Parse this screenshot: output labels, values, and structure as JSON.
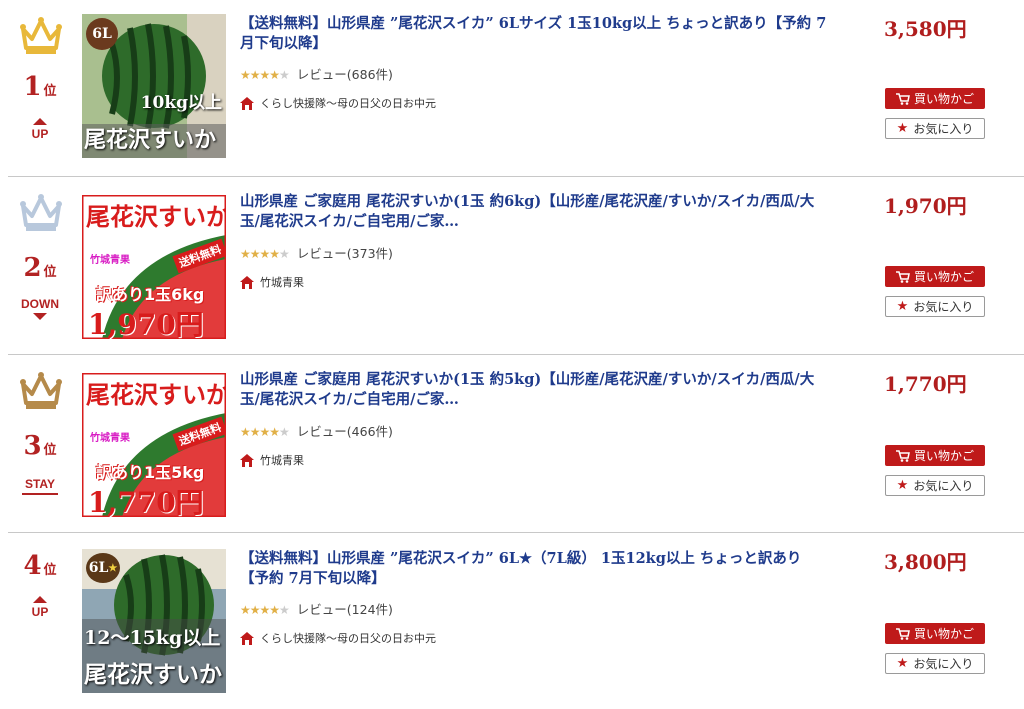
{
  "ranking": {
    "items": [
      {
        "rank": "1",
        "rank_suffix": "位",
        "trend": "UP",
        "crown_color": "#e8b83a",
        "title": "【送料無料】山形県産 ”尾花沢スイカ” 6Lサイズ 1玉10kg以上 ちょっと訳あり【予約 7月下旬以降】",
        "rating_stars": 4,
        "review_label": "レビュー(686件)",
        "shop": "くらし快援隊〜母の日父の日お中元",
        "price": "3,580円",
        "cart_label": "買い物かご",
        "fav_label": "お気に入り",
        "thumb_text": {
          "badge": "6L",
          "weight": "10kg以上",
          "name": "尾花沢すいか"
        }
      },
      {
        "rank": "2",
        "rank_suffix": "位",
        "trend": "DOWN",
        "crown_color": "#b8c8dc",
        "title": "山形県産 ご家庭用 尾花沢すいか(1玉 約6kg)【山形産/尾花沢産/すいか/スイカ/西瓜/大玉/尾花沢スイカ/ご自宅用/ご家…",
        "rating_stars": 4,
        "review_label": "レビュー(373件)",
        "shop": "竹城青果",
        "price": "1,970円",
        "cart_label": "買い物かご",
        "fav_label": "お気に入り",
        "thumb_text": {
          "name": "尾花沢すいか",
          "shop": "竹城青果",
          "tag": "送料無料",
          "desc": "訳あり1玉6kg",
          "price": "1,970円"
        }
      },
      {
        "rank": "3",
        "rank_suffix": "位",
        "trend": "STAY",
        "crown_color": "#b58a4a",
        "title": "山形県産 ご家庭用 尾花沢すいか(1玉 約5kg)【山形産/尾花沢産/すいか/スイカ/西瓜/大玉/尾花沢スイカ/ご自宅用/ご家…",
        "rating_stars": 4,
        "review_label": "レビュー(466件)",
        "shop": "竹城青果",
        "price": "1,770円",
        "cart_label": "買い物かご",
        "fav_label": "お気に入り",
        "thumb_text": {
          "name": "尾花沢すいか",
          "shop": "竹城青果",
          "tag": "送料無料",
          "desc": "訳あり1玉5kg",
          "price": "1,770円"
        }
      },
      {
        "rank": "4",
        "rank_suffix": "位",
        "trend": "UP",
        "crown_color": "",
        "title": "【送料無料】山形県産 ”尾花沢スイカ” 6L★（7L級） 1玉12kg以上 ちょっと訳あり【予約 7月下旬以降】",
        "rating_stars": 4,
        "review_label": "レビュー(124件)",
        "shop": "くらし快援隊〜母の日父の日お中元",
        "price": "3,800円",
        "cart_label": "買い物かご",
        "fav_label": "お気に入り",
        "thumb_text": {
          "badge": "6L",
          "weight": "12〜15kg以上",
          "name": "尾花沢すいか"
        }
      }
    ]
  },
  "colors": {
    "accent": "#b22222",
    "link": "#1f3b8c",
    "star": "#e1b047",
    "cart": "#bf1a1a"
  }
}
